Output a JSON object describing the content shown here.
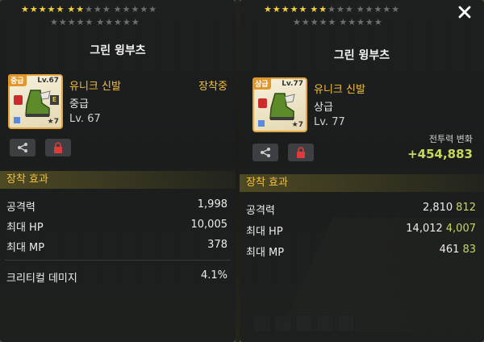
{
  "left_panel": {
    "item_name": "그린 윙부츠",
    "grade_tag": "중급",
    "level_tag": "Lv.67",
    "star_count": "7",
    "item_type": "유니크 신발",
    "grade": "중급",
    "level": "Lv. 67",
    "equipped": "장착중",
    "section_title": "장착 효과",
    "stats": [
      {
        "label": "공격력",
        "value": "1,998"
      },
      {
        "label": "최대 HP",
        "value": "10,005"
      },
      {
        "label": "최대 MP",
        "value": "378"
      }
    ],
    "extra_stat": {
      "label": "크리티컬 데미지",
      "value": "4.1%"
    },
    "stars_row1": {
      "filled_groups": 1,
      "partial_filled": 2
    },
    "colors": {
      "accent": "#f5c040",
      "lock": "#cc2b2b"
    }
  },
  "right_panel": {
    "item_name": "그린 윙부츠",
    "grade_tag": "상급",
    "level_tag": "Lv.77",
    "star_count": "7",
    "item_type": "유니크 신발",
    "grade": "상급",
    "level": "Lv. 77",
    "power_label": "전투력 변화",
    "power_value": "+454,883",
    "section_title": "장착 효과",
    "stats": [
      {
        "label": "공격력",
        "value": "2,810",
        "bonus": "812"
      },
      {
        "label": "최대 HP",
        "value": "14,012",
        "bonus": "4,007"
      },
      {
        "label": "최대 MP",
        "value": "461",
        "bonus": "83"
      }
    ],
    "colors": {
      "bonus": "#c7d85a"
    }
  },
  "icons": {
    "share": "share-icon",
    "lock": "lock-icon",
    "close": "close-icon"
  }
}
